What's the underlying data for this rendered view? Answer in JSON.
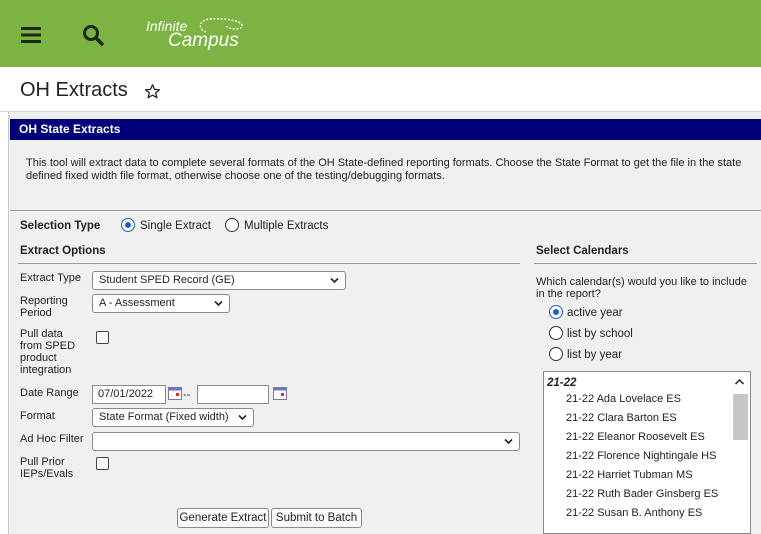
{
  "app": {
    "logo_line1": "Infinite",
    "logo_line2": "Campus"
  },
  "page": {
    "title": "OH Extracts"
  },
  "panel": {
    "header": "OH State Extracts",
    "description": "This tool will extract data to complete several formats of the OH State-defined reporting formats. Choose the State Format to get the file in the state defined fixed width file format, otherwise choose one of the testing/debugging formats."
  },
  "selection_type": {
    "label": "Selection Type",
    "options": [
      {
        "label": "Single Extract",
        "selected": true
      },
      {
        "label": "Multiple Extracts",
        "selected": false
      }
    ]
  },
  "extract_options": {
    "heading": "Extract Options",
    "extract_type": {
      "label": "Extract Type",
      "value": "Student SPED Record (GE)"
    },
    "reporting_period": {
      "label_line1": "Reporting",
      "label_line2": "Period",
      "value": "A - Assessment"
    },
    "pull_sped": {
      "label_lines": [
        "Pull data",
        "from SPED",
        "product",
        "integration"
      ],
      "checked": false
    },
    "date_range": {
      "label": "Date Range",
      "start": "07/01/2022",
      "separator": "--",
      "end": ""
    },
    "format": {
      "label": "Format",
      "value": "State Format (Fixed width)"
    },
    "ad_hoc": {
      "label": "Ad Hoc Filter",
      "value": ""
    },
    "pull_prior": {
      "label_line1": "Pull Prior",
      "label_line2": "IEPs/Evals",
      "checked": false
    }
  },
  "buttons": {
    "generate": "Generate Extract",
    "batch": "Submit to Batch"
  },
  "calendars": {
    "heading": "Select Calendars",
    "question": "Which calendar(s) would you like to include in the report?",
    "options": [
      {
        "label": "active year",
        "selected": true
      },
      {
        "label": "list by school",
        "selected": false
      },
      {
        "label": "list by year",
        "selected": false
      }
    ],
    "group": "21-22",
    "items": [
      "21-22 Ada Lovelace ES",
      "21-22 Clara Barton ES",
      "21-22 Eleanor Roosevelt ES",
      "21-22 Florence Nightingale HS",
      "21-22 Harriet Tubman MS",
      "21-22 Ruth Bader Ginsberg ES",
      "21-22 Susan B. Anthony ES"
    ]
  },
  "colors": {
    "topbar": "#7cb342",
    "panel_header": "#00007a",
    "radio_selected": "#1a5fd0"
  },
  "icons": [
    "menu-icon",
    "search-icon",
    "star-icon",
    "calendar-icon",
    "chevron-down-icon",
    "scroll-up-icon"
  ]
}
